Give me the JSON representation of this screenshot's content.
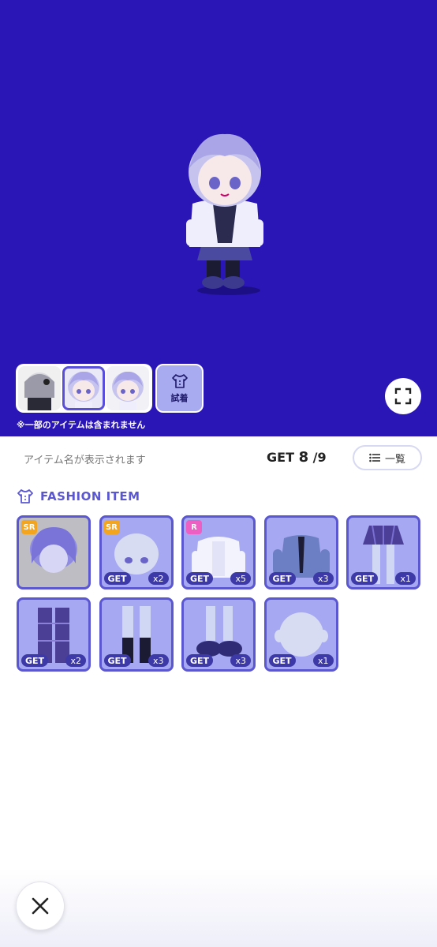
{
  "preview": {
    "note": "※一部のアイテムは含まれません",
    "try_on_label": "試着",
    "bg_color": "#2a16b6",
    "thumbnails": [
      {
        "name": "outfit-thumb-1",
        "selected": false
      },
      {
        "name": "outfit-thumb-2",
        "selected": true
      },
      {
        "name": "outfit-thumb-3",
        "selected": false
      }
    ]
  },
  "info": {
    "item_name_placeholder": "アイテム名が表示されます",
    "get_label": "GET",
    "get_count": "8",
    "get_total": "/9",
    "list_button_label": "一覧"
  },
  "section": {
    "title": "FASHION ITEM",
    "icon": "shirt-icon"
  },
  "items": [
    {
      "rarity": "SR",
      "get": "",
      "qty": "",
      "kind": "hair"
    },
    {
      "rarity": "SR",
      "get": "GET",
      "qty": "x2",
      "kind": "face"
    },
    {
      "rarity": "R",
      "get": "GET",
      "qty": "x5",
      "kind": "jacket"
    },
    {
      "rarity": "",
      "get": "GET",
      "qty": "x3",
      "kind": "shirt"
    },
    {
      "rarity": "",
      "get": "GET",
      "qty": "x1",
      "kind": "skirt"
    },
    {
      "rarity": "",
      "get": "GET",
      "qty": "x2",
      "kind": "pants"
    },
    {
      "rarity": "",
      "get": "GET",
      "qty": "x3",
      "kind": "socks"
    },
    {
      "rarity": "",
      "get": "GET",
      "qty": "x3",
      "kind": "shoes"
    },
    {
      "rarity": "",
      "get": "GET",
      "qty": "x1",
      "kind": "head"
    }
  ],
  "colors": {
    "accent": "#5a57d0",
    "card_bg": "#a6a8f2",
    "sr_badge": "#f4a51f",
    "r_badge": "#ee5fc4"
  }
}
